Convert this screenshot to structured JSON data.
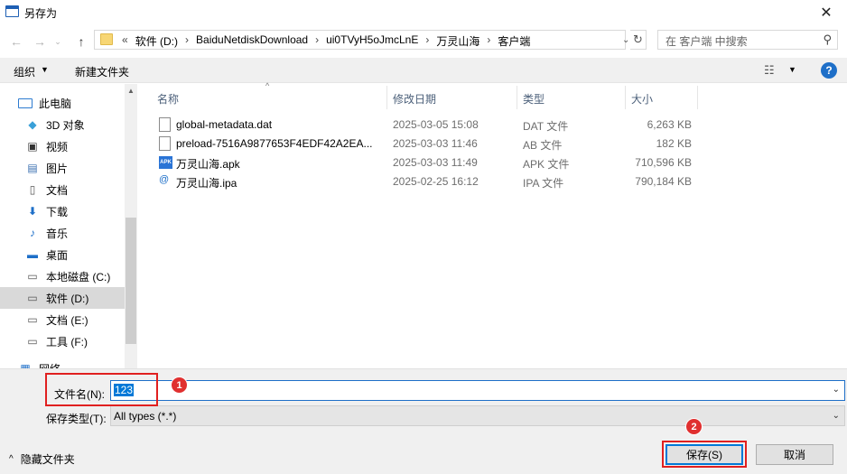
{
  "window": {
    "title": "另存为",
    "close_glyph": "✕"
  },
  "nav": {
    "breadcrumb": [
      "软件 (D:)",
      "BaiduNetdiskDownload",
      "ui0TVyH5oJmcLnE",
      "万灵山海",
      "客户端"
    ],
    "overflow": "«",
    "search_placeholder": "在 客户端 中搜索"
  },
  "toolbar": {
    "organize": "组织",
    "new_folder": "新建文件夹"
  },
  "sidebar": {
    "items": [
      {
        "label": "此电脑",
        "icon": "computer-icon"
      },
      {
        "label": "3D 对象",
        "icon": "cube-icon"
      },
      {
        "label": "视频",
        "icon": "video-icon"
      },
      {
        "label": "图片",
        "icon": "picture-icon"
      },
      {
        "label": "文档",
        "icon": "document-icon"
      },
      {
        "label": "下载",
        "icon": "download-icon"
      },
      {
        "label": "音乐",
        "icon": "music-icon"
      },
      {
        "label": "桌面",
        "icon": "desktop-icon"
      },
      {
        "label": "本地磁盘 (C:)",
        "icon": "drive-icon"
      },
      {
        "label": "软件 (D:)",
        "icon": "drive-icon",
        "selected": true
      },
      {
        "label": "文档 (E:)",
        "icon": "drive-icon"
      },
      {
        "label": "工具 (F:)",
        "icon": "drive-icon"
      },
      {
        "label": "网络",
        "icon": "network-icon"
      }
    ]
  },
  "filelist": {
    "columns": {
      "name": "名称",
      "modified": "修改日期",
      "type": "类型",
      "size": "大小"
    },
    "rows": [
      {
        "name": "global-metadata.dat",
        "modified": "2025-03-05 15:08",
        "type": "DAT 文件",
        "size": "6,263 KB",
        "icon": "file-icon"
      },
      {
        "name": "preload-7516A9877653F4EDF42A2EA...",
        "modified": "2025-03-03 11:46",
        "type": "AB 文件",
        "size": "182 KB",
        "icon": "file-icon"
      },
      {
        "name": "万灵山海.apk",
        "modified": "2025-03-03 11:49",
        "type": "APK 文件",
        "size": "710,596 KB",
        "icon": "apk-icon"
      },
      {
        "name": "万灵山海.ipa",
        "modified": "2025-02-25 16:12",
        "type": "IPA 文件",
        "size": "790,184 KB",
        "icon": "ipa-icon"
      }
    ]
  },
  "form": {
    "filename_label": "文件名(N):",
    "filename_value": "123",
    "filetype_label": "保存类型(T):",
    "filetype_value": "All types (*.*)",
    "hide_folders": "隐藏文件夹",
    "save": "保存(S)",
    "cancel": "取消"
  },
  "annotations": {
    "badge_1": "1",
    "badge_2": "2"
  },
  "colors": {
    "accent": "#0078d7",
    "annotation": "#e02020"
  }
}
